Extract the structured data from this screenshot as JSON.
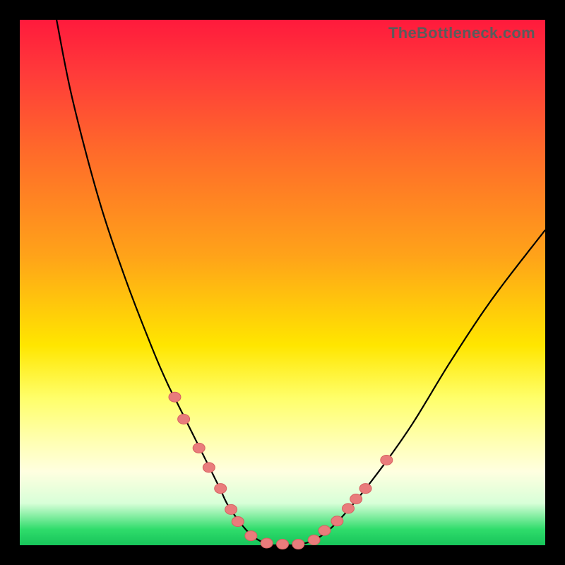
{
  "watermark": "TheBottleneck.com",
  "chart_data": {
    "type": "line",
    "title": "",
    "xlabel": "",
    "ylabel": "",
    "xlim": [
      0,
      100
    ],
    "ylim": [
      0,
      100
    ],
    "grid": false,
    "series": [
      {
        "name": "curve",
        "x": [
          7,
          10,
          15,
          20,
          25,
          28,
          30,
          32,
          34,
          36,
          38,
          40,
          44,
          48,
          52,
          56,
          60,
          66,
          74,
          82,
          90,
          100
        ],
        "values": [
          100,
          85,
          66,
          51,
          38,
          31,
          27,
          23,
          19,
          15,
          11,
          7,
          2,
          0,
          0,
          1,
          4,
          11,
          22,
          35,
          47,
          60
        ]
      }
    ],
    "scatter_points": {
      "name": "dots",
      "x": [
        29.5,
        31.2,
        34.1,
        36.0,
        38.2,
        40.2,
        41.5,
        44.0,
        47.0,
        50.0,
        53.0,
        56.0,
        58.0,
        60.4,
        62.5,
        64.0,
        65.8,
        69.8
      ],
      "values": [
        28.2,
        24.0,
        18.5,
        14.8,
        10.8,
        6.8,
        4.5,
        1.8,
        0.4,
        0.2,
        0.2,
        1.0,
        2.8,
        4.6,
        7.0,
        8.8,
        10.8,
        16.2
      ]
    },
    "colors": {
      "background_gradient": [
        "#ff1a3c",
        "#ff6a2a",
        "#ffe600",
        "#ffffe0",
        "#17c45a"
      ],
      "curve": "#000000",
      "dots_fill": "#e97c7c",
      "dots_stroke": "#d76060"
    }
  }
}
